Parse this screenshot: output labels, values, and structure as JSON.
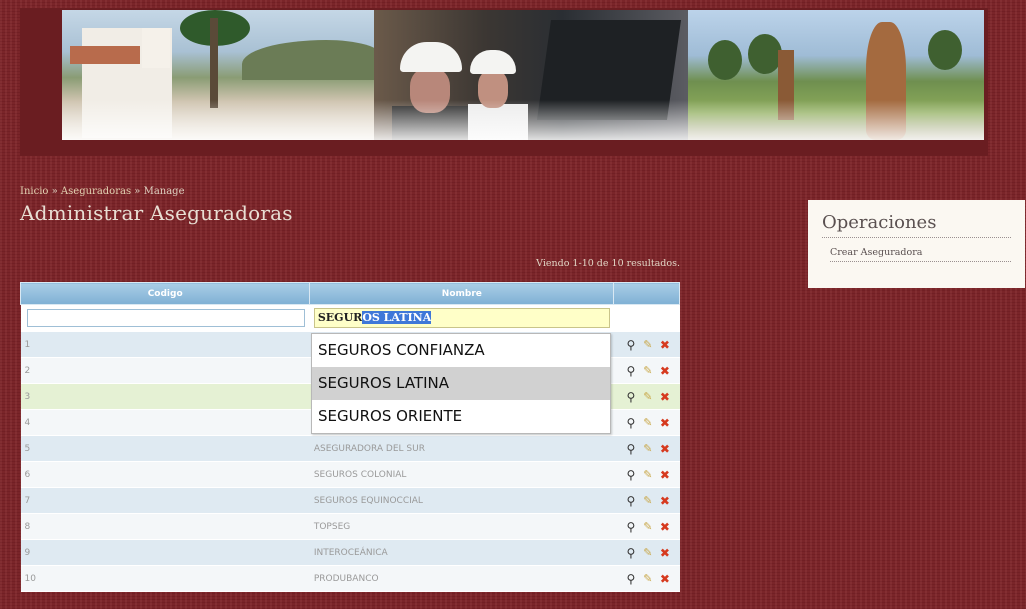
{
  "breadcrumb": {
    "home": "Inicio",
    "sep1": "»",
    "section": "Aseguradoras",
    "sep2": "»",
    "current": "Manage"
  },
  "page_title": "Administrar Aseguradoras",
  "summary": "Viendo 1-10 de 10 resultados.",
  "table": {
    "headers": [
      "Codigo",
      "Nombre"
    ],
    "filter": {
      "codigo": "",
      "nombre_typed": "SEGUR",
      "nombre_selected": "OS LATINA"
    },
    "rows": [
      {
        "codigo": "1",
        "nombre": ""
      },
      {
        "codigo": "2",
        "nombre": ""
      },
      {
        "codigo": "3",
        "nombre": ""
      },
      {
        "codigo": "4",
        "nombre": ""
      },
      {
        "codigo": "5",
        "nombre": "ASEGURADORA DEL SUR"
      },
      {
        "codigo": "6",
        "nombre": "SEGUROS COLONIAL"
      },
      {
        "codigo": "7",
        "nombre": "SEGUROS EQUINOCCIAL"
      },
      {
        "codigo": "8",
        "nombre": "TOPSEG"
      },
      {
        "codigo": "9",
        "nombre": "INTEROCEÁNICA"
      },
      {
        "codigo": "10",
        "nombre": "PRODUBANCO"
      }
    ],
    "action_icons": [
      "view-icon",
      "edit-icon",
      "delete-icon"
    ]
  },
  "autocomplete": {
    "options": [
      "SEGUROS CONFIANZA",
      "SEGUROS LATINA",
      "SEGUROS ORIENTE"
    ],
    "active": "SEGUROS LATINA"
  },
  "sidebar": {
    "title": "Operaciones",
    "link": "Crear Aseguradora"
  },
  "colors": {
    "background": "#7c2227",
    "header": "#7fb0d4",
    "row_odd": "#dfeaf2",
    "row_even": "#f4f7f9",
    "row_highlight": "#e5f1d4"
  }
}
